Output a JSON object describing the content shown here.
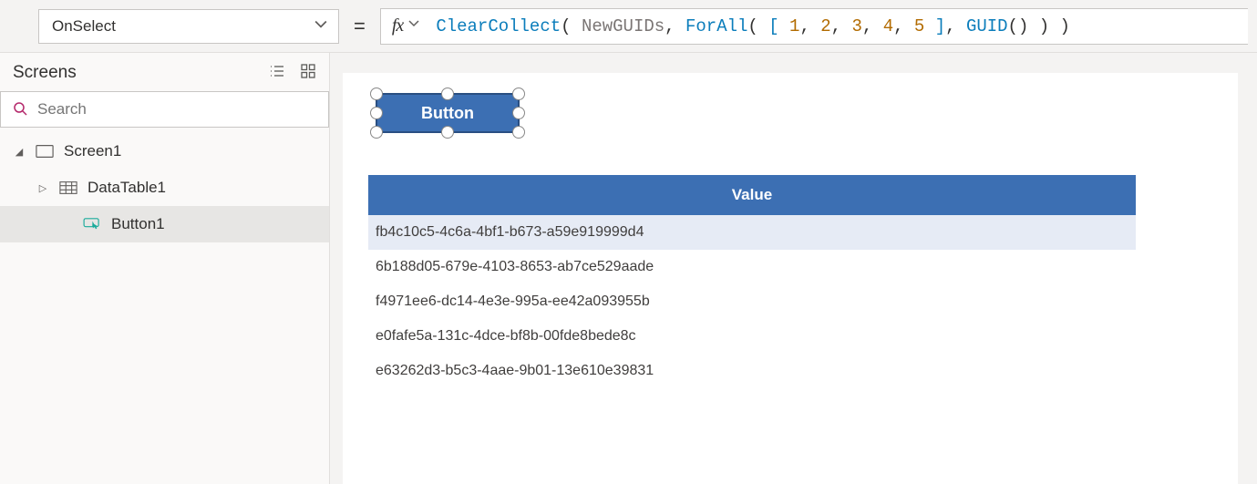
{
  "property": {
    "selected": "OnSelect"
  },
  "formula": {
    "tokens": [
      {
        "t": "func",
        "v": "ClearCollect"
      },
      {
        "t": "paren",
        "v": "( "
      },
      {
        "t": "name",
        "v": "NewGUIDs"
      },
      {
        "t": "plain",
        "v": ", "
      },
      {
        "t": "func",
        "v": "ForAll"
      },
      {
        "t": "paren",
        "v": "( "
      },
      {
        "t": "func",
        "v": "[ "
      },
      {
        "t": "num",
        "v": "1"
      },
      {
        "t": "plain",
        "v": ", "
      },
      {
        "t": "num",
        "v": "2"
      },
      {
        "t": "plain",
        "v": ", "
      },
      {
        "t": "num",
        "v": "3"
      },
      {
        "t": "plain",
        "v": ", "
      },
      {
        "t": "num",
        "v": "4"
      },
      {
        "t": "plain",
        "v": ", "
      },
      {
        "t": "num",
        "v": "5"
      },
      {
        "t": "func",
        "v": " ]"
      },
      {
        "t": "plain",
        "v": ", "
      },
      {
        "t": "func",
        "v": "GUID"
      },
      {
        "t": "paren",
        "v": "() ) )"
      }
    ]
  },
  "panel": {
    "title": "Screens",
    "search_placeholder": "Search"
  },
  "tree": {
    "screen_label": "Screen1",
    "datatable_label": "DataTable1",
    "button_label": "Button1"
  },
  "canvas": {
    "button_text": "Button",
    "table_header": "Value",
    "rows": [
      "fb4c10c5-4c6a-4bf1-b673-a59e919999d4",
      "6b188d05-679e-4103-8653-ab7ce529aade",
      "f4971ee6-dc14-4e3e-995a-ee42a093955b",
      "e0fafe5a-131c-4dce-bf8b-00fde8bede8c",
      "e63262d3-b5c3-4aae-9b01-13e610e39831"
    ]
  }
}
